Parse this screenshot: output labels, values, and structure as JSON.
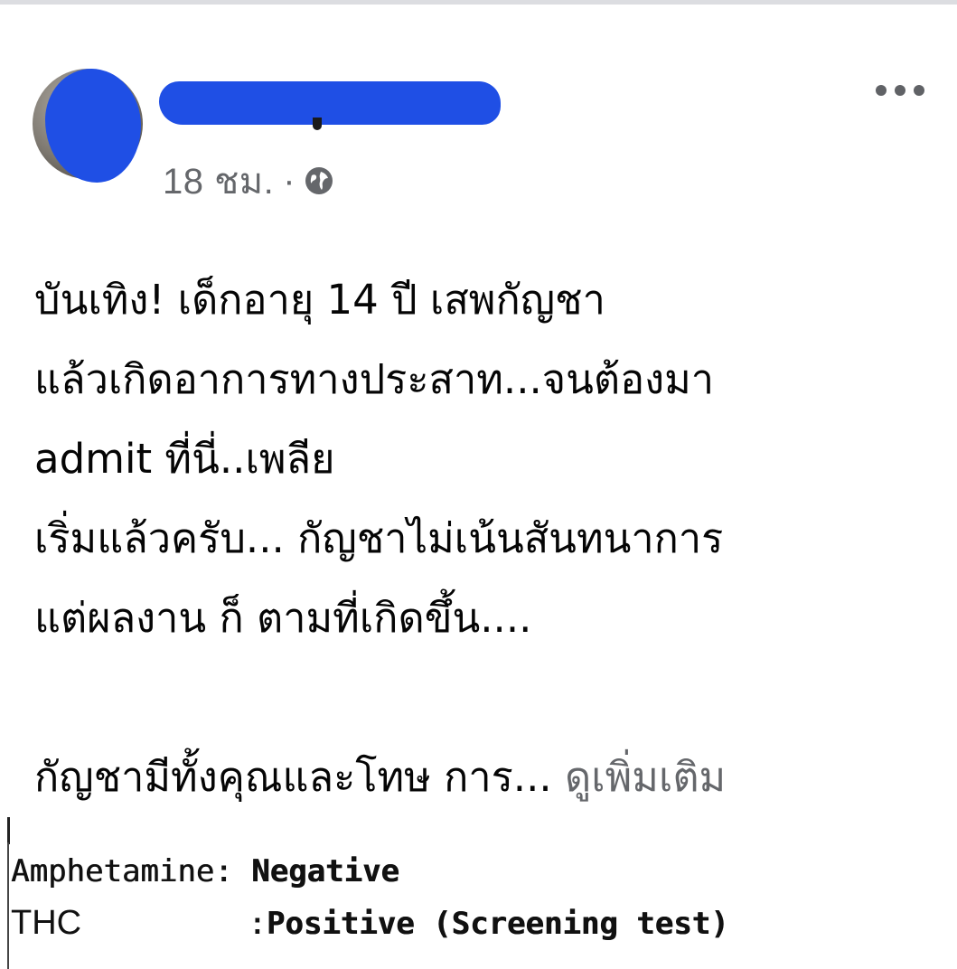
{
  "post": {
    "time": "18 ชม.",
    "separator": "·",
    "privacy_icon": "globe-icon",
    "more_icon": "more-options-icon",
    "text_lines": [
      "บันเทิง! เด็กอายุ 14 ปี เสพกัญชา",
      "แล้วเกิดอาการทางประสาท...จนต้องมา",
      "admit ที่นี่..เพลีย",
      "เริ่มแล้วครับ... กัญชาไม่เน้นสันทนาการ",
      "แต่ผลงาน ก็ ตามที่เกิดขึ้น...."
    ],
    "last_line": "กัญชามีทั้งคุณและโทษ การ...",
    "see_more": "ดูเพิ่มเติม"
  },
  "attachment": {
    "lab_results": [
      {
        "name": "Amphetamine",
        "separator": ": ",
        "result": "Negative"
      },
      {
        "name": "THC",
        "separator": "         :",
        "result": "Positive (Screening test)"
      }
    ]
  },
  "colors": {
    "censor": "#1f4fe5",
    "meta_text": "#65676b",
    "body_text": "#050505"
  }
}
